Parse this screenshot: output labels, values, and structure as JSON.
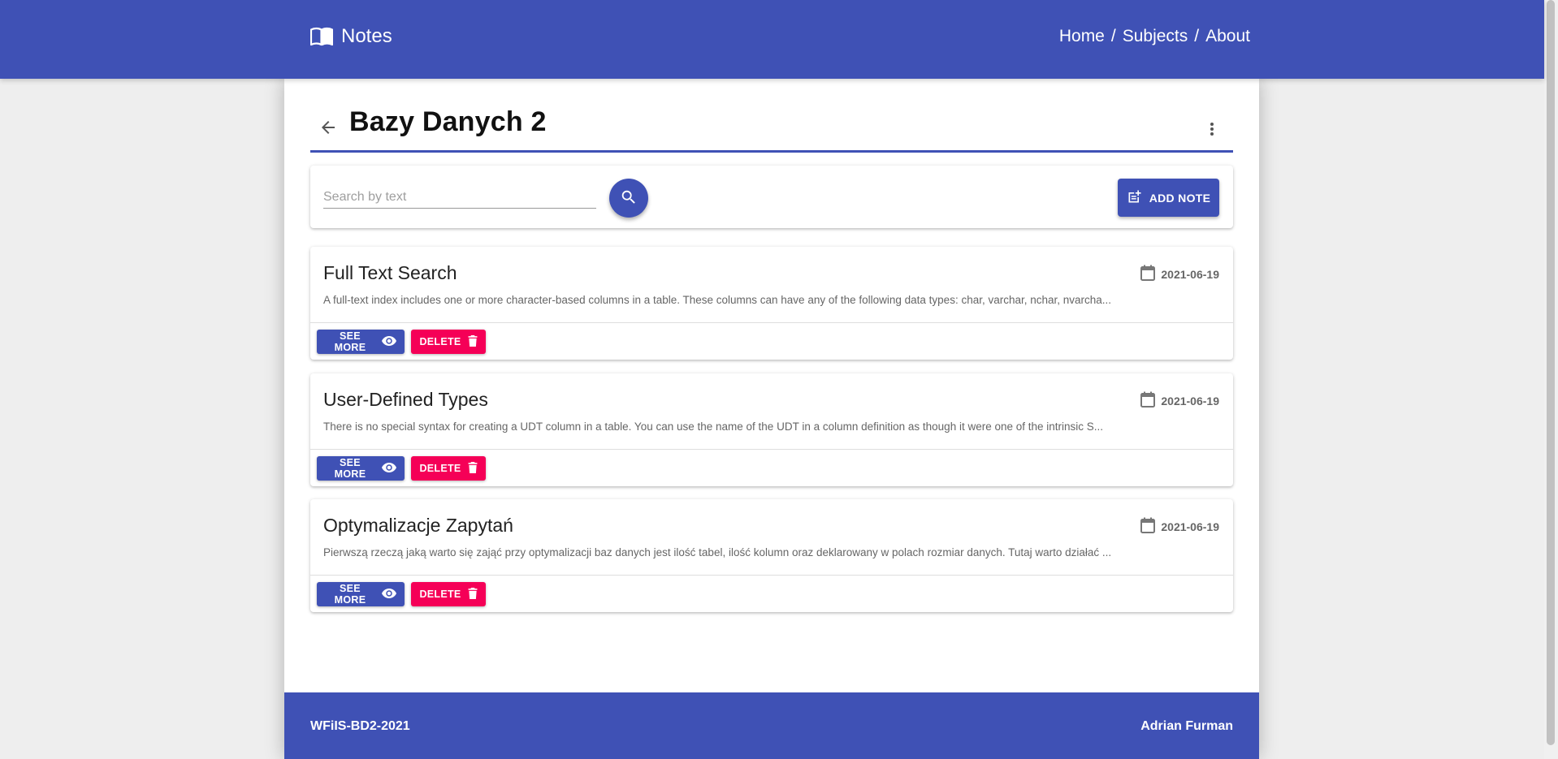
{
  "header": {
    "brand": "Notes",
    "nav": [
      {
        "label": "Home"
      },
      {
        "label": "Subjects"
      },
      {
        "label": "About"
      }
    ],
    "separator": "/"
  },
  "page": {
    "title": "Bazy Danych 2"
  },
  "search": {
    "placeholder": "Search by text",
    "value": ""
  },
  "add_note_label": "ADD NOTE",
  "notes": [
    {
      "title": "Full Text Search",
      "date": "2021-06-19",
      "excerpt": "A full-text index includes one or more character-based columns in a table. These columns can have any of the following data types: char, varchar, nchar, nvarcha..."
    },
    {
      "title": "User-Defined Types",
      "date": "2021-06-19",
      "excerpt": "There is no special syntax for creating a UDT column in a table. You can use the name of the UDT in a column definition as though it were one of the intrinsic S..."
    },
    {
      "title": "Optymalizacje Zapytań",
      "date": "2021-06-19",
      "excerpt": "Pierwszą rzeczą jaką warto się zająć przy optymalizacji baz danych jest ilość tabel, ilość kolumn oraz deklarowany w polach rozmiar danych. Tutaj warto działać ..."
    }
  ],
  "buttons": {
    "see_more": "SEE MORE",
    "delete": "DELETE"
  },
  "footer": {
    "left": "WFiIS-BD2-2021",
    "right": "Adrian Furman"
  },
  "icons": {
    "brand": "book-open-icon",
    "back": "arrow-left-icon",
    "more": "more-vertical-icon",
    "search": "search-icon",
    "add_note": "note-add-icon",
    "date": "calendar-icon",
    "see_more": "eye-icon",
    "delete": "trash-icon"
  },
  "colors": {
    "primary": "#3f51b5",
    "secondary": "#f50057",
    "background": "#eeeeee"
  }
}
